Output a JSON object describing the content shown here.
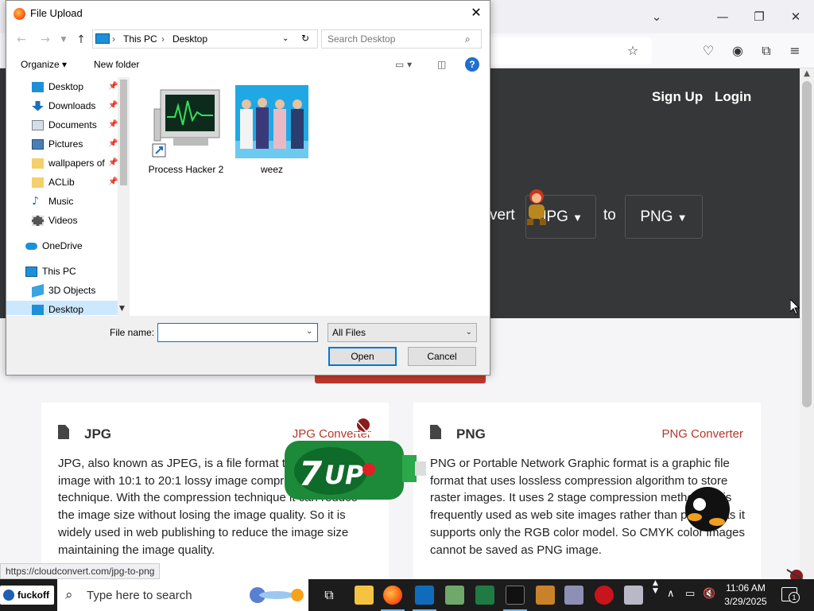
{
  "colors": {
    "accent": "#0078d7",
    "hero_bg": "#363738",
    "brand_red": "#c0392b",
    "link_red": "#b5362b",
    "taskbar": "#1c1c1c"
  },
  "browser": {
    "window_controls": {
      "list_all_tabs": "⌄",
      "minimize": "—",
      "restore": "❐",
      "close": "✕"
    },
    "toolbar_icons": [
      "star-icon",
      "pocket-icon",
      "account-icon",
      "extensions-icon",
      "menu-icon"
    ],
    "page": {
      "nav": {
        "sign_up": "Sign Up",
        "login": "Login"
      },
      "hero": {
        "convert_prefix": "vert",
        "from_format": "JPG",
        "to_word": "to",
        "to_format": "PNG"
      },
      "cards": [
        {
          "title": "JPG",
          "link": "JPG Converter",
          "body": "JPG, also known as JPEG, is a file format that can contain image with 10:1 to 20:1 lossy image compression technique. With the compression technique it can reduce the image size without losing the image quality. So it is widely used in web publishing to reduce the image size maintaining the image quality."
        },
        {
          "title": "PNG",
          "link": "PNG Converter",
          "body": "PNG or Portable Network Graphic format is a graphic file format that uses lossless compression algorithm to store raster images. It uses 2 stage compression methods. It is frequently used as web site images rather than printing as it supports only the RGB color model. So CMYK color images cannot be saved as PNG image."
        }
      ]
    },
    "status_url": "https://cloudconvert.com/jpg-to-png"
  },
  "dialog": {
    "title": "File Upload",
    "breadcrumb": [
      "This PC",
      "Desktop"
    ],
    "search_placeholder": "Search Desktop",
    "toolbar": {
      "organize": "Organize ▾",
      "new_folder": "New folder"
    },
    "nav_items": [
      {
        "label": "Desktop",
        "icon": "desktop-icon",
        "pinned": true
      },
      {
        "label": "Downloads",
        "icon": "downloads-icon",
        "pinned": true
      },
      {
        "label": "Documents",
        "icon": "documents-icon",
        "pinned": true
      },
      {
        "label": "Pictures",
        "icon": "pictures-icon",
        "pinned": true
      },
      {
        "label": "wallpapers of",
        "icon": "folder-icon",
        "pinned": true
      },
      {
        "label": "ACLib",
        "icon": "folder-icon",
        "pinned": true
      },
      {
        "label": "Music",
        "icon": "music-icon",
        "pinned": false
      },
      {
        "label": "Videos",
        "icon": "videos-icon",
        "pinned": false
      },
      {
        "label": "OneDrive",
        "icon": "onedrive-icon",
        "pinned": false
      },
      {
        "label": "This PC",
        "icon": "this-pc-icon",
        "pinned": false
      },
      {
        "label": "3D Objects",
        "icon": "3d-objects-icon",
        "pinned": false
      },
      {
        "label": "Desktop",
        "icon": "desktop-icon",
        "pinned": false,
        "selected": true
      }
    ],
    "files": [
      {
        "name": "Process Hacker 2",
        "icon": "process-hacker-shortcut-icon"
      },
      {
        "name": "weez",
        "icon": "album-image-thumbnail"
      }
    ],
    "file_name_label": "File name:",
    "file_name_value": "",
    "file_type": "All Files",
    "open_label": "Open",
    "cancel_label": "Cancel"
  },
  "taskbar": {
    "start_label": "fuckoff",
    "search_placeholder": "Type here to search",
    "apps": [
      "task-view-icon",
      "file-explorer-icon",
      "firefox-icon",
      "outlook-icon",
      "app-cube-icon",
      "excel-icon",
      "terminal-icon",
      "game-app-icon",
      "dog-app-icon",
      "red-app-icon",
      "app-icon"
    ],
    "clock_time": "11:06 AM",
    "clock_date": "3/29/2025",
    "notification_count": "1"
  }
}
